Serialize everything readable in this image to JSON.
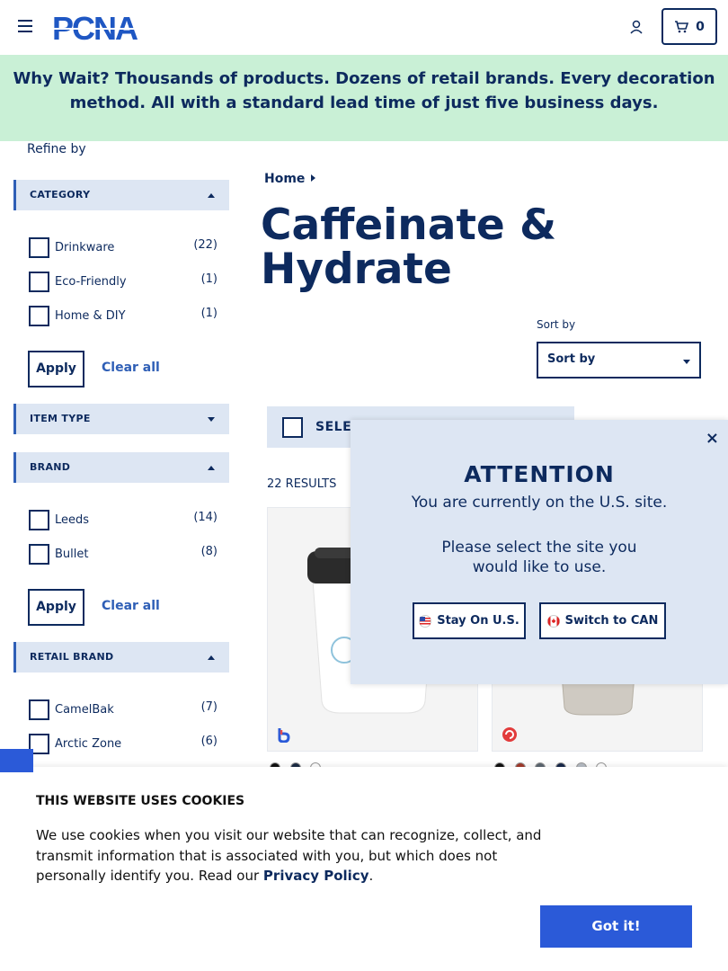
{
  "header": {
    "logo_text": "PCNA",
    "cart_count": "0"
  },
  "banner": {
    "lead": "Why Wait?",
    "text": "Thousands of products. Dozens of retail brands. Every decoration method. All with a standard lead time of just five business days."
  },
  "sidebar": {
    "refine_label": "Refine by",
    "category": {
      "title": "CATEGORY",
      "options": [
        {
          "label": "Drinkware",
          "count": "(22)"
        },
        {
          "label": "Eco-Friendly",
          "count": "(1)"
        },
        {
          "label": "Home & DIY",
          "count": "(1)"
        }
      ]
    },
    "item_type": {
      "title": "ITEM TYPE"
    },
    "brand": {
      "title": "BRAND",
      "options": [
        {
          "label": "Leeds",
          "count": "(14)"
        },
        {
          "label": "Bullet",
          "count": "(8)"
        }
      ]
    },
    "retail_brand": {
      "title": "RETAIL BRAND",
      "options": [
        {
          "label": "CamelBak",
          "count": "(7)"
        },
        {
          "label": "Arctic Zone",
          "count": "(6)"
        }
      ]
    },
    "apply_label": "Apply",
    "clear_label": "Clear all"
  },
  "main": {
    "breadcrumb": "Home",
    "title": "Caffeinate & Hydrate",
    "sort_label": "Sort by",
    "sort_value": "Sort by",
    "select_all": "SELEC",
    "results": "22 RESULTS"
  },
  "modal": {
    "title": "ATTENTION",
    "line1": "You are currently on the U.S. site.",
    "line2": "Please select the site you",
    "line3": "would like to use.",
    "stay_label": "Stay On U.S.",
    "switch_label": "Switch to CAN",
    "close": "×"
  },
  "cookie": {
    "title": "THIS WEBSITE USES COOKIES",
    "text": "We use cookies when you visit our website that can recognize, collect, and transmit information that is associated with you, but which does not personally identify you. Read our",
    "link": "Privacy Policy",
    "period": ".",
    "button": "Got it!"
  },
  "colors": {
    "navy": "#0d2a5e",
    "accent_blue": "#2b5ad8",
    "banner_green": "#c9f0d6",
    "facet_bg": "#dde6f3"
  }
}
